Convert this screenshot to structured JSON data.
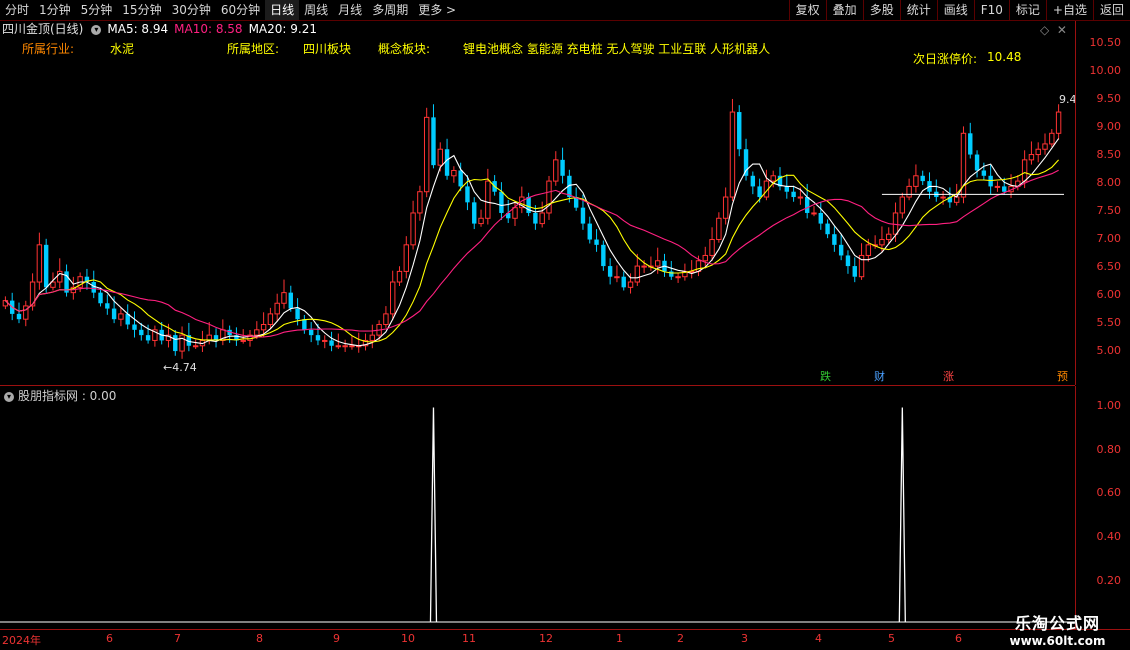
{
  "toolbar": {
    "periods": [
      "分时",
      "1分钟",
      "5分钟",
      "15分钟",
      "30分钟",
      "60分钟",
      "日线",
      "周线",
      "月线",
      "多周期",
      "更多"
    ],
    "active_period": "日线",
    "more_arrow": ">",
    "buttons": [
      "复权",
      "叠加",
      "多股",
      "统计",
      "画线",
      "F10",
      "标记",
      "+自选",
      "返回"
    ]
  },
  "title": {
    "stock": "四川金顶(日线)",
    "ma5": "MA5: 8.94",
    "ma10": "MA10: 8.58",
    "ma20": "MA20: 9.21"
  },
  "info": {
    "industry_label": "所属行业:",
    "industry_value": "水泥",
    "region_label": "所属地区:",
    "region_value": "四川板块",
    "concept_label": "概念板块:",
    "concept_value": "锂电池概念 氢能源 充电桩 无人驾驶 工业互联 人形机器人",
    "limit_label": "次日涨停价:",
    "limit_value": "10.48"
  },
  "price_axis": [
    "10.50",
    "10.00",
    "9.50",
    "9.00",
    "8.50",
    "8.00",
    "7.50",
    "7.00",
    "6.50",
    "6.00",
    "5.50",
    "5.00"
  ],
  "annotations": {
    "low_mark": "←4.74",
    "high_mark": "9.4"
  },
  "badges": [
    {
      "text": "跌",
      "color": "#33cc33"
    },
    {
      "text": "财",
      "color": "#4aa0ff"
    },
    {
      "text": "涨",
      "color": "#ff4444"
    },
    {
      "text": "预",
      "color": "#ff8800"
    }
  ],
  "indicator": {
    "title": "股朋指标网 : 0.00",
    "axis": [
      "1.00",
      "0.80",
      "0.60",
      "0.40",
      "0.20"
    ],
    "spikes": [
      0.993,
      0.993
    ]
  },
  "months": [
    "2024年",
    "6",
    "7",
    "8",
    "9",
    "10",
    "11",
    "12",
    "1",
    "2",
    "3",
    "4",
    "5",
    "6"
  ],
  "watermark": {
    "line1": "乐淘公式网",
    "line2": "www.60lt.com"
  },
  "colors": {
    "up": "#ff3333",
    "down": "#00ccff",
    "ma5": "#ffffff",
    "ma10": "#ffff00",
    "ma20": "#ff2080",
    "axis": "#ee3333"
  },
  "chart_data": {
    "type": "candlestick",
    "title": "",
    "ylim": [
      4.6,
      10.7
    ],
    "close": [
      5.85,
      5.6,
      5.5,
      5.75,
      6.2,
      6.9,
      6.1,
      6.2,
      6.4,
      6.0,
      6.1,
      6.3,
      6.2,
      6.0,
      5.8,
      5.7,
      5.5,
      5.6,
      5.4,
      5.3,
      5.2,
      5.1,
      5.3,
      5.1,
      5.2,
      4.9,
      5.2,
      5.0,
      5.0,
      5.1,
      5.2,
      5.1,
      5.3,
      5.2,
      5.1,
      5.1,
      5.2,
      5.3,
      5.4,
      5.6,
      5.8,
      6.0,
      5.7,
      5.5,
      5.3,
      5.2,
      5.1,
      5.1,
      5.0,
      5.0,
      5.0,
      5.0,
      5.0,
      5.1,
      5.2,
      5.4,
      5.6,
      6.2,
      6.4,
      6.9,
      7.5,
      7.9,
      9.3,
      8.4,
      8.7,
      8.2,
      8.3,
      8.0,
      7.7,
      7.3,
      7.4,
      8.1,
      7.9,
      7.5,
      7.4,
      7.6,
      7.8,
      7.5,
      7.3,
      7.5,
      8.1,
      8.5,
      8.2,
      7.8,
      7.6,
      7.3,
      7.0,
      6.9,
      6.5,
      6.3,
      6.3,
      6.1,
      6.2,
      6.5,
      6.5,
      6.5,
      6.6,
      6.4,
      6.3,
      6.3,
      6.4,
      6.4,
      6.6,
      6.7,
      7.0,
      7.4,
      7.8,
      9.4,
      8.7,
      8.2,
      8.0,
      7.8,
      8.1,
      8.2,
      8.0,
      7.9,
      7.8,
      7.8,
      7.5,
      7.5,
      7.3,
      7.1,
      6.9,
      6.7,
      6.5,
      6.3,
      6.7,
      6.9,
      6.9,
      7.0,
      7.1,
      7.5,
      7.8,
      8.0,
      8.2,
      8.1,
      7.9,
      7.8,
      7.8,
      7.7,
      7.8,
      9.0,
      8.6,
      8.3,
      8.2,
      8.0,
      8.0,
      7.9,
      8.0,
      8.1,
      8.5,
      8.6,
      8.7,
      8.8,
      9.0,
      9.4
    ]
  }
}
